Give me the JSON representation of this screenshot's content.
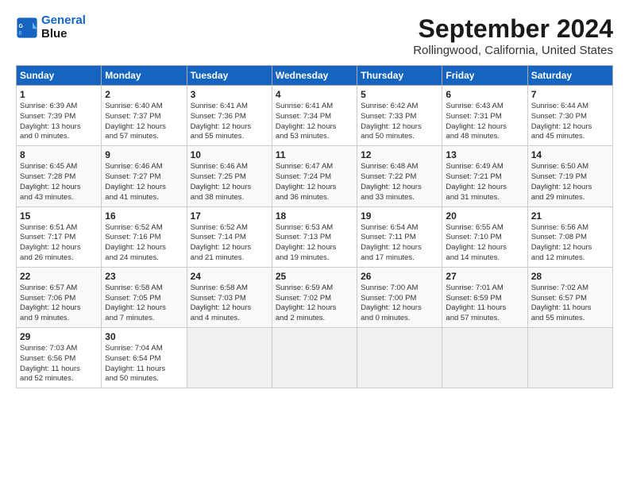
{
  "logo": {
    "line1": "General",
    "line2": "Blue"
  },
  "title": "September 2024",
  "subtitle": "Rollingwood, California, United States",
  "days_of_week": [
    "Sunday",
    "Monday",
    "Tuesday",
    "Wednesday",
    "Thursday",
    "Friday",
    "Saturday"
  ],
  "weeks": [
    [
      {
        "day": "1",
        "info": "Sunrise: 6:39 AM\nSunset: 7:39 PM\nDaylight: 13 hours\nand 0 minutes."
      },
      {
        "day": "2",
        "info": "Sunrise: 6:40 AM\nSunset: 7:37 PM\nDaylight: 12 hours\nand 57 minutes."
      },
      {
        "day": "3",
        "info": "Sunrise: 6:41 AM\nSunset: 7:36 PM\nDaylight: 12 hours\nand 55 minutes."
      },
      {
        "day": "4",
        "info": "Sunrise: 6:41 AM\nSunset: 7:34 PM\nDaylight: 12 hours\nand 53 minutes."
      },
      {
        "day": "5",
        "info": "Sunrise: 6:42 AM\nSunset: 7:33 PM\nDaylight: 12 hours\nand 50 minutes."
      },
      {
        "day": "6",
        "info": "Sunrise: 6:43 AM\nSunset: 7:31 PM\nDaylight: 12 hours\nand 48 minutes."
      },
      {
        "day": "7",
        "info": "Sunrise: 6:44 AM\nSunset: 7:30 PM\nDaylight: 12 hours\nand 45 minutes."
      }
    ],
    [
      {
        "day": "8",
        "info": "Sunrise: 6:45 AM\nSunset: 7:28 PM\nDaylight: 12 hours\nand 43 minutes."
      },
      {
        "day": "9",
        "info": "Sunrise: 6:46 AM\nSunset: 7:27 PM\nDaylight: 12 hours\nand 41 minutes."
      },
      {
        "day": "10",
        "info": "Sunrise: 6:46 AM\nSunset: 7:25 PM\nDaylight: 12 hours\nand 38 minutes."
      },
      {
        "day": "11",
        "info": "Sunrise: 6:47 AM\nSunset: 7:24 PM\nDaylight: 12 hours\nand 36 minutes."
      },
      {
        "day": "12",
        "info": "Sunrise: 6:48 AM\nSunset: 7:22 PM\nDaylight: 12 hours\nand 33 minutes."
      },
      {
        "day": "13",
        "info": "Sunrise: 6:49 AM\nSunset: 7:21 PM\nDaylight: 12 hours\nand 31 minutes."
      },
      {
        "day": "14",
        "info": "Sunrise: 6:50 AM\nSunset: 7:19 PM\nDaylight: 12 hours\nand 29 minutes."
      }
    ],
    [
      {
        "day": "15",
        "info": "Sunrise: 6:51 AM\nSunset: 7:17 PM\nDaylight: 12 hours\nand 26 minutes."
      },
      {
        "day": "16",
        "info": "Sunrise: 6:52 AM\nSunset: 7:16 PM\nDaylight: 12 hours\nand 24 minutes."
      },
      {
        "day": "17",
        "info": "Sunrise: 6:52 AM\nSunset: 7:14 PM\nDaylight: 12 hours\nand 21 minutes."
      },
      {
        "day": "18",
        "info": "Sunrise: 6:53 AM\nSunset: 7:13 PM\nDaylight: 12 hours\nand 19 minutes."
      },
      {
        "day": "19",
        "info": "Sunrise: 6:54 AM\nSunset: 7:11 PM\nDaylight: 12 hours\nand 17 minutes."
      },
      {
        "day": "20",
        "info": "Sunrise: 6:55 AM\nSunset: 7:10 PM\nDaylight: 12 hours\nand 14 minutes."
      },
      {
        "day": "21",
        "info": "Sunrise: 6:56 AM\nSunset: 7:08 PM\nDaylight: 12 hours\nand 12 minutes."
      }
    ],
    [
      {
        "day": "22",
        "info": "Sunrise: 6:57 AM\nSunset: 7:06 PM\nDaylight: 12 hours\nand 9 minutes."
      },
      {
        "day": "23",
        "info": "Sunrise: 6:58 AM\nSunset: 7:05 PM\nDaylight: 12 hours\nand 7 minutes."
      },
      {
        "day": "24",
        "info": "Sunrise: 6:58 AM\nSunset: 7:03 PM\nDaylight: 12 hours\nand 4 minutes."
      },
      {
        "day": "25",
        "info": "Sunrise: 6:59 AM\nSunset: 7:02 PM\nDaylight: 12 hours\nand 2 minutes."
      },
      {
        "day": "26",
        "info": "Sunrise: 7:00 AM\nSunset: 7:00 PM\nDaylight: 12 hours\nand 0 minutes."
      },
      {
        "day": "27",
        "info": "Sunrise: 7:01 AM\nSunset: 6:59 PM\nDaylight: 11 hours\nand 57 minutes."
      },
      {
        "day": "28",
        "info": "Sunrise: 7:02 AM\nSunset: 6:57 PM\nDaylight: 11 hours\nand 55 minutes."
      }
    ],
    [
      {
        "day": "29",
        "info": "Sunrise: 7:03 AM\nSunset: 6:56 PM\nDaylight: 11 hours\nand 52 minutes."
      },
      {
        "day": "30",
        "info": "Sunrise: 7:04 AM\nSunset: 6:54 PM\nDaylight: 11 hours\nand 50 minutes."
      },
      {
        "day": "",
        "info": ""
      },
      {
        "day": "",
        "info": ""
      },
      {
        "day": "",
        "info": ""
      },
      {
        "day": "",
        "info": ""
      },
      {
        "day": "",
        "info": ""
      }
    ]
  ]
}
